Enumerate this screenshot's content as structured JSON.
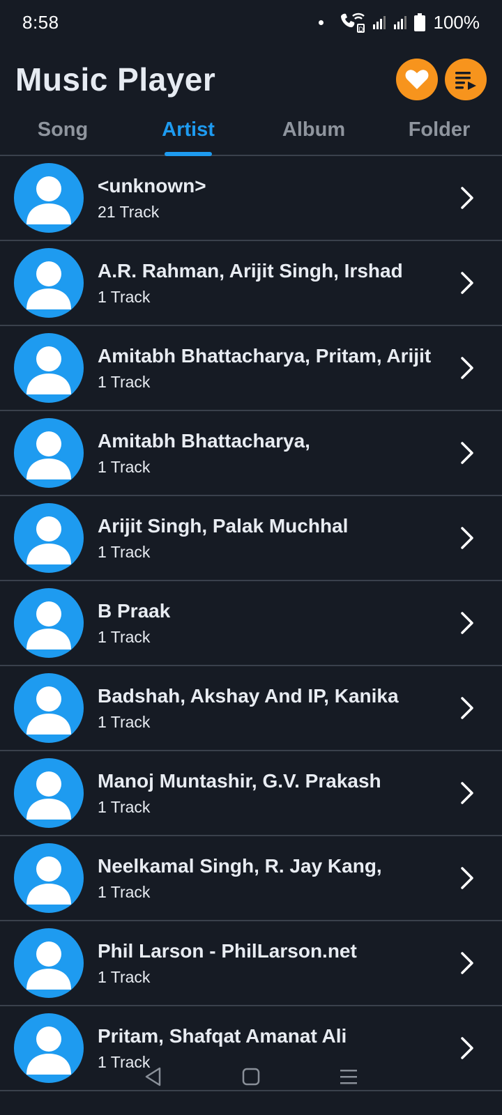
{
  "status_bar": {
    "time": "8:58",
    "battery": "100%"
  },
  "header": {
    "title": "Music Player",
    "favorite_icon": "heart-icon",
    "playlist_icon": "playlist-play-icon",
    "accent_color": "#f7941d"
  },
  "tabs": [
    {
      "label": "Song",
      "active": false
    },
    {
      "label": "Artist",
      "active": true
    },
    {
      "label": "Album",
      "active": false
    },
    {
      "label": "Folder",
      "active": false
    }
  ],
  "theme": {
    "background": "#161b24",
    "active_tab_color": "#1e9bf0",
    "avatar_color": "#1e9bf0"
  },
  "artists": [
    {
      "name": "<unknown>",
      "count": "21 Track"
    },
    {
      "name": "A.R. Rahman, Arijit Singh, Irshad",
      "count": "1 Track"
    },
    {
      "name": "Amitabh Bhattacharya, Pritam, Arijit",
      "count": "1 Track"
    },
    {
      "name": "Amitabh Bhattacharya,",
      "count": "1 Track"
    },
    {
      "name": "Arijit Singh, Palak Muchhal",
      "count": "1 Track"
    },
    {
      "name": "B Praak",
      "count": "1 Track"
    },
    {
      "name": "Badshah, Akshay And IP, Kanika",
      "count": "1 Track"
    },
    {
      "name": "Manoj Muntashir, G.V. Prakash",
      "count": "1 Track"
    },
    {
      "name": "Neelkamal Singh, R. Jay Kang,",
      "count": "1 Track"
    },
    {
      "name": "Phil Larson - PhilLarson.net",
      "count": "1 Track"
    },
    {
      "name": "Pritam, Shafqat Amanat Ali",
      "count": "1 Track"
    }
  ]
}
